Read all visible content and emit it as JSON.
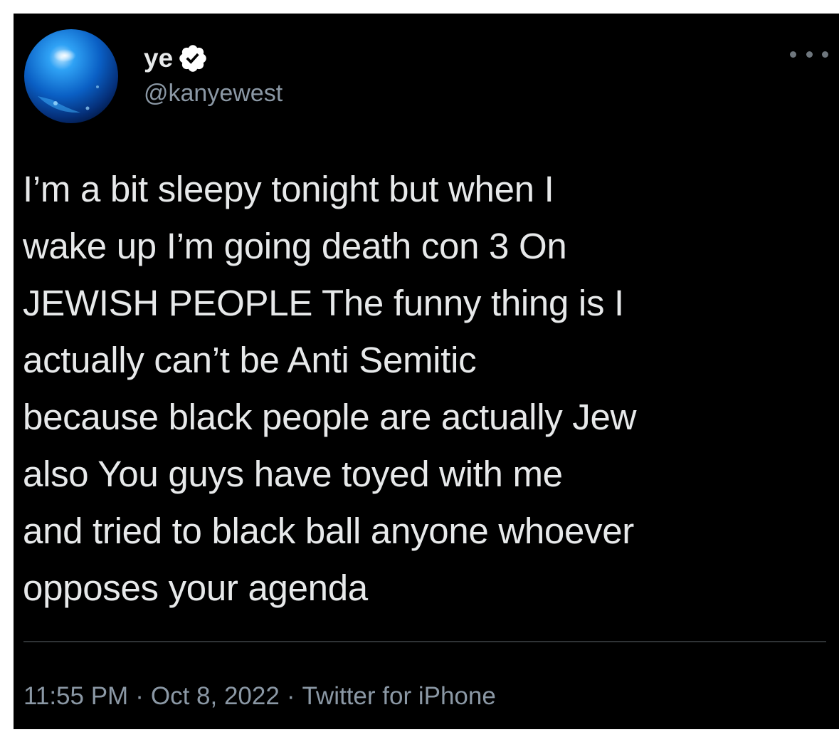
{
  "tweet": {
    "display_name": "ye",
    "handle": "@kanyewest",
    "text": "I’m a bit sleepy tonight but when I\nwake up I’m going death con 3      On\nJEWISH PEOPLE     The funny thing is I\nactually can’t be Anti Semitic\nbecause black people are actually Jew\nalso    You guys have toyed with me\nand tried to black ball anyone whoever\nopposes your agenda",
    "time": "11:55 PM",
    "separator": "·",
    "date": "Oct 8, 2022",
    "client": "Twitter for iPhone",
    "verified": true
  },
  "icons": {
    "avatar": "blue-sphere-avatar",
    "badge": "verified-badge-icon",
    "more": "more-options-icon"
  },
  "colors": {
    "background": "#000000",
    "text_primary": "#e7e9ea",
    "text_secondary": "#8b98a5",
    "divider": "#2f3336"
  }
}
